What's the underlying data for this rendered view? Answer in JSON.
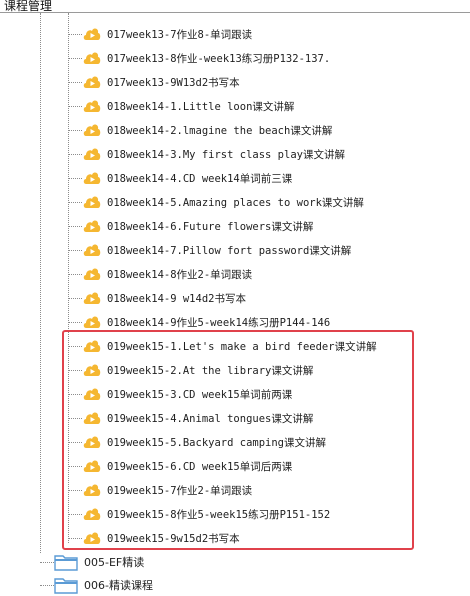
{
  "header": {
    "title": "课程管理"
  },
  "lessons": [
    {
      "label": "017week13-7作业8-单词跟读"
    },
    {
      "label": "017week13-8作业-week13练习册P132-137."
    },
    {
      "label": "017week13-9W13d2书写本"
    },
    {
      "label": "018week14-1.Little loon课文讲解"
    },
    {
      "label": "018week14-2.lmagine the beach课文讲解"
    },
    {
      "label": "018week14-3.My first class play课文讲解"
    },
    {
      "label": "018week14-4.CD week14单词前三课"
    },
    {
      "label": "018week14-5.Amazing places to work课文讲解"
    },
    {
      "label": "018week14-6.Future flowers课文讲解"
    },
    {
      "label": "018week14-7.Pillow fort password课文讲解"
    },
    {
      "label": "018week14-8作业2-单词跟读"
    },
    {
      "label": "018week14-9 w14d2书写本"
    },
    {
      "label": "018week14-9作业5-week14练习册P144-146"
    },
    {
      "label": "019week15-1.Let's make a bird feeder课文讲解"
    },
    {
      "label": "019week15-2.At the library课文讲解"
    },
    {
      "label": "019week15-3.CD week15单词前两课"
    },
    {
      "label": "019week15-4.Animal tongues课文讲解"
    },
    {
      "label": "019week15-5.Backyard camping课文讲解"
    },
    {
      "label": "019week15-6.CD week15单词后两课"
    },
    {
      "label": "019week15-7作业2-单词跟读"
    },
    {
      "label": "019week15-8作业5-week15练习册P151-152"
    },
    {
      "label": "019week15-9w15d2书写本"
    }
  ],
  "folders": [
    {
      "label": "005-EF精读"
    },
    {
      "label": "006-精读课程"
    }
  ],
  "colors": {
    "play_icon": "#f5b731",
    "selection_border": "#e0414b",
    "folder_icon": "#5b9bd5"
  }
}
